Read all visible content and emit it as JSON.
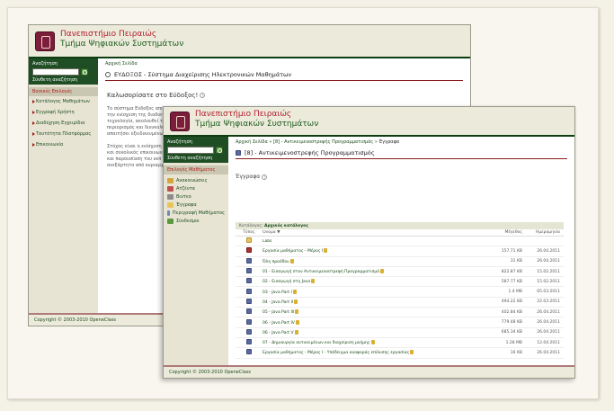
{
  "back_window": {
    "header": {
      "university": "Πανεπιστήμιο Πειραιώς",
      "department": "Τμήμα Ψηφιακών Συστημάτων"
    },
    "sidebar": {
      "search_label": "Αναζήτηση",
      "advanced_search": "Σύνθετη αναζήτηση",
      "section_title": "Βασικές Επιλογές",
      "items": [
        {
          "label": "Κατάλογος Μαθημάτων"
        },
        {
          "label": "Εγγραφή Χρήστη"
        },
        {
          "label": "Διαδέχηση Εγχειρίδια"
        },
        {
          "label": "Ταυτότητα Πλατφόρμας"
        },
        {
          "label": "Επικοινωνία"
        }
      ]
    },
    "main": {
      "breadcrumb": "Αρχική Σελίδα",
      "title": "ΕΥΔΟΞΟΣ - Σύστημα Διαχείρισης Ηλεκτρονικών Μαθημάτων",
      "welcome": "Καλωσορίσατε στο Εύδοξος!",
      "paragraphs": [
        "Το σύστημα Εύδοξος απο",
        "την ενίσχυση της διαδικτ",
        "τεχνολογία, ακολουθεί τη",
        "περιορισμός και διευκολύ",
        "απαιτήσει εξειδικευμένων τ",
        "Στόχος είναι η ενίσχυση τ",
        "και συνολικός επικοινωνίας",
        "και παρουσίαση του εκπ",
        "ανεξάρτητο από κυριαρχίες"
      ]
    },
    "footer": "Copyright © 2003-2010 OpeneClass"
  },
  "front_window": {
    "header": {
      "university": "Πανεπιστήμιο Πειραιώς",
      "department": "Τμήμα Ψηφιακών Συστημάτων"
    },
    "sidebar": {
      "search_label": "Αναζήτηση",
      "advanced_search": "Σύνθετη αναζήτηση",
      "section_title": "Επιλογές Μαθήματος",
      "tools": [
        {
          "label": "Ανακοινώσεις",
          "icon": "megaphone-icon",
          "color": "#d4a63a"
        },
        {
          "label": "Ατζέντα",
          "icon": "calendar-icon",
          "color": "#c0504d"
        },
        {
          "label": "Βιντεο",
          "icon": "video-icon",
          "color": "#8c8c8c"
        },
        {
          "label": "Έγγραφα",
          "icon": "folder-icon",
          "color": "#e8c45a"
        },
        {
          "label": "Περιγραφή Μαθήματος",
          "icon": "info-icon",
          "color": "#6b8bb5"
        },
        {
          "label": "Σύνδεσμοι",
          "icon": "link-icon",
          "color": "#5a9a3e"
        }
      ]
    },
    "main": {
      "breadcrumb": {
        "home": "Αρχική Σελίδα",
        "course": "[8] - Αντικειμενοστρεφής Προγραμματισμός",
        "current": "Έγγραφα"
      },
      "title": "[8] - Αντικειμενοστρεφής Προγραμματισμός",
      "subtitle": "Έγγραφα",
      "directory": {
        "label": "Κατάλογος:",
        "value": "Αρχικός κατάλογος"
      },
      "columns": {
        "type": "Τύπος",
        "name": "Όνομα ▼",
        "size": "Μέγεθος",
        "date": "Ημερομηνία"
      },
      "rows": [
        {
          "type": "folder",
          "name": "Labs",
          "size": "",
          "date": "",
          "lock": false
        },
        {
          "type": "pdf",
          "name": "Εργασία μαθήματος - Μέρος I",
          "size": "157.71 KB",
          "date": "26.04.2011",
          "lock": true
        },
        {
          "type": "doc",
          "name": "Όλη προόδου",
          "size": "31 KB",
          "date": "26.04.2011",
          "lock": true
        },
        {
          "type": "doc",
          "name": "01 - Εισαγωγή στον Αντικειμενοστρεφή Προγραμματισμό",
          "size": "822.87 KB",
          "date": "15.02.2011",
          "lock": true
        },
        {
          "type": "doc",
          "name": "02 - Εισαγωγή στη Java",
          "size": "587.77 KB",
          "date": "15.02.2011",
          "lock": true
        },
        {
          "type": "doc",
          "name": "03 - Java Part I",
          "size": "1.4 MB",
          "date": "05.03.2011",
          "lock": true
        },
        {
          "type": "doc",
          "name": "04 - Java Part II",
          "size": "494.22 KB",
          "date": "22.03.2011",
          "lock": true
        },
        {
          "type": "doc",
          "name": "05 - Java Part III",
          "size": "402.84 KB",
          "date": "26.04.2011",
          "lock": true
        },
        {
          "type": "doc",
          "name": "06 - Java Part IV",
          "size": "779.48 KB",
          "date": "26.04.2011",
          "lock": true
        },
        {
          "type": "doc",
          "name": "06 - Java Part V",
          "size": "685.34 KB",
          "date": "26.04.2011",
          "lock": true
        },
        {
          "type": "doc",
          "name": "07 - Δημιουργία αντικειμένων και διαχείριση μνήμης",
          "size": "1.28 MB",
          "date": "12.04.2011",
          "lock": true
        },
        {
          "type": "doc",
          "name": "Εργασία μαθήματος - Μέρος I - Υπόδειγμα αναφοράς επίλυσης εργασίας",
          "size": "16 KB",
          "date": "26.04.2011",
          "lock": true
        }
      ]
    },
    "footer": "Copyright © 2003-2010 OpeneClass"
  }
}
